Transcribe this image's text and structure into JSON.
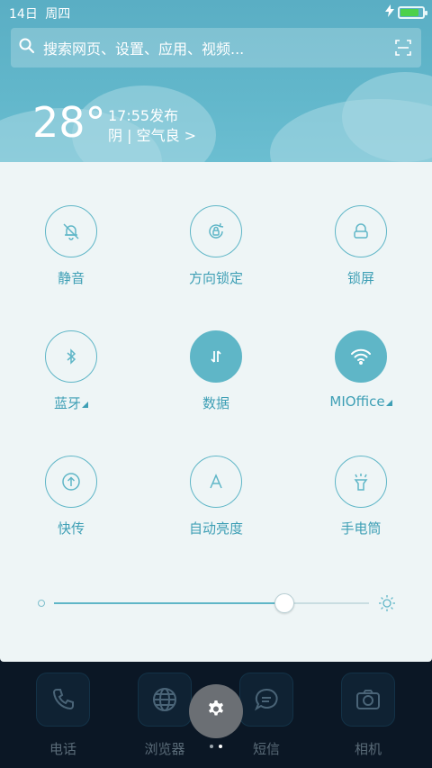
{
  "status": {
    "date": "14日",
    "weekday": "周四",
    "battery_percent": 85
  },
  "search": {
    "placeholder": "搜索网页、设置、应用、视频..."
  },
  "weather": {
    "temperature": "28°",
    "published": "17:55发布",
    "condition": "阴 | 空气良 >"
  },
  "toggles": [
    {
      "label": "静音",
      "icon": "bell-off-icon",
      "active": false
    },
    {
      "label": "方向锁定",
      "icon": "rotation-lock-icon",
      "active": false
    },
    {
      "label": "锁屏",
      "icon": "lock-icon",
      "active": false
    },
    {
      "label": "蓝牙",
      "icon": "bluetooth-icon",
      "active": false,
      "expandable": true
    },
    {
      "label": "数据",
      "icon": "mobile-data-icon",
      "active": true
    },
    {
      "label": "MIOffice",
      "icon": "wifi-icon",
      "active": true,
      "expandable": true
    },
    {
      "label": "快传",
      "icon": "share-icon",
      "active": false
    },
    {
      "label": "自动亮度",
      "icon": "auto-brightness-icon",
      "active": false
    },
    {
      "label": "手电筒",
      "icon": "flashlight-icon",
      "active": false
    }
  ],
  "brightness": {
    "level": 0.73
  },
  "dock": {
    "apps": [
      {
        "label": "电话",
        "icon": "phone-icon"
      },
      {
        "label": "浏览器",
        "icon": "globe-icon"
      },
      {
        "label": "短信",
        "icon": "message-icon"
      },
      {
        "label": "相机",
        "icon": "camera-icon"
      }
    ],
    "settings_icon": "gear-icon",
    "page_count": 2,
    "current_page": 1
  },
  "colors": {
    "accent": "#5fb6c7",
    "header": "#62b7cb",
    "panel": "#eef5f6"
  }
}
